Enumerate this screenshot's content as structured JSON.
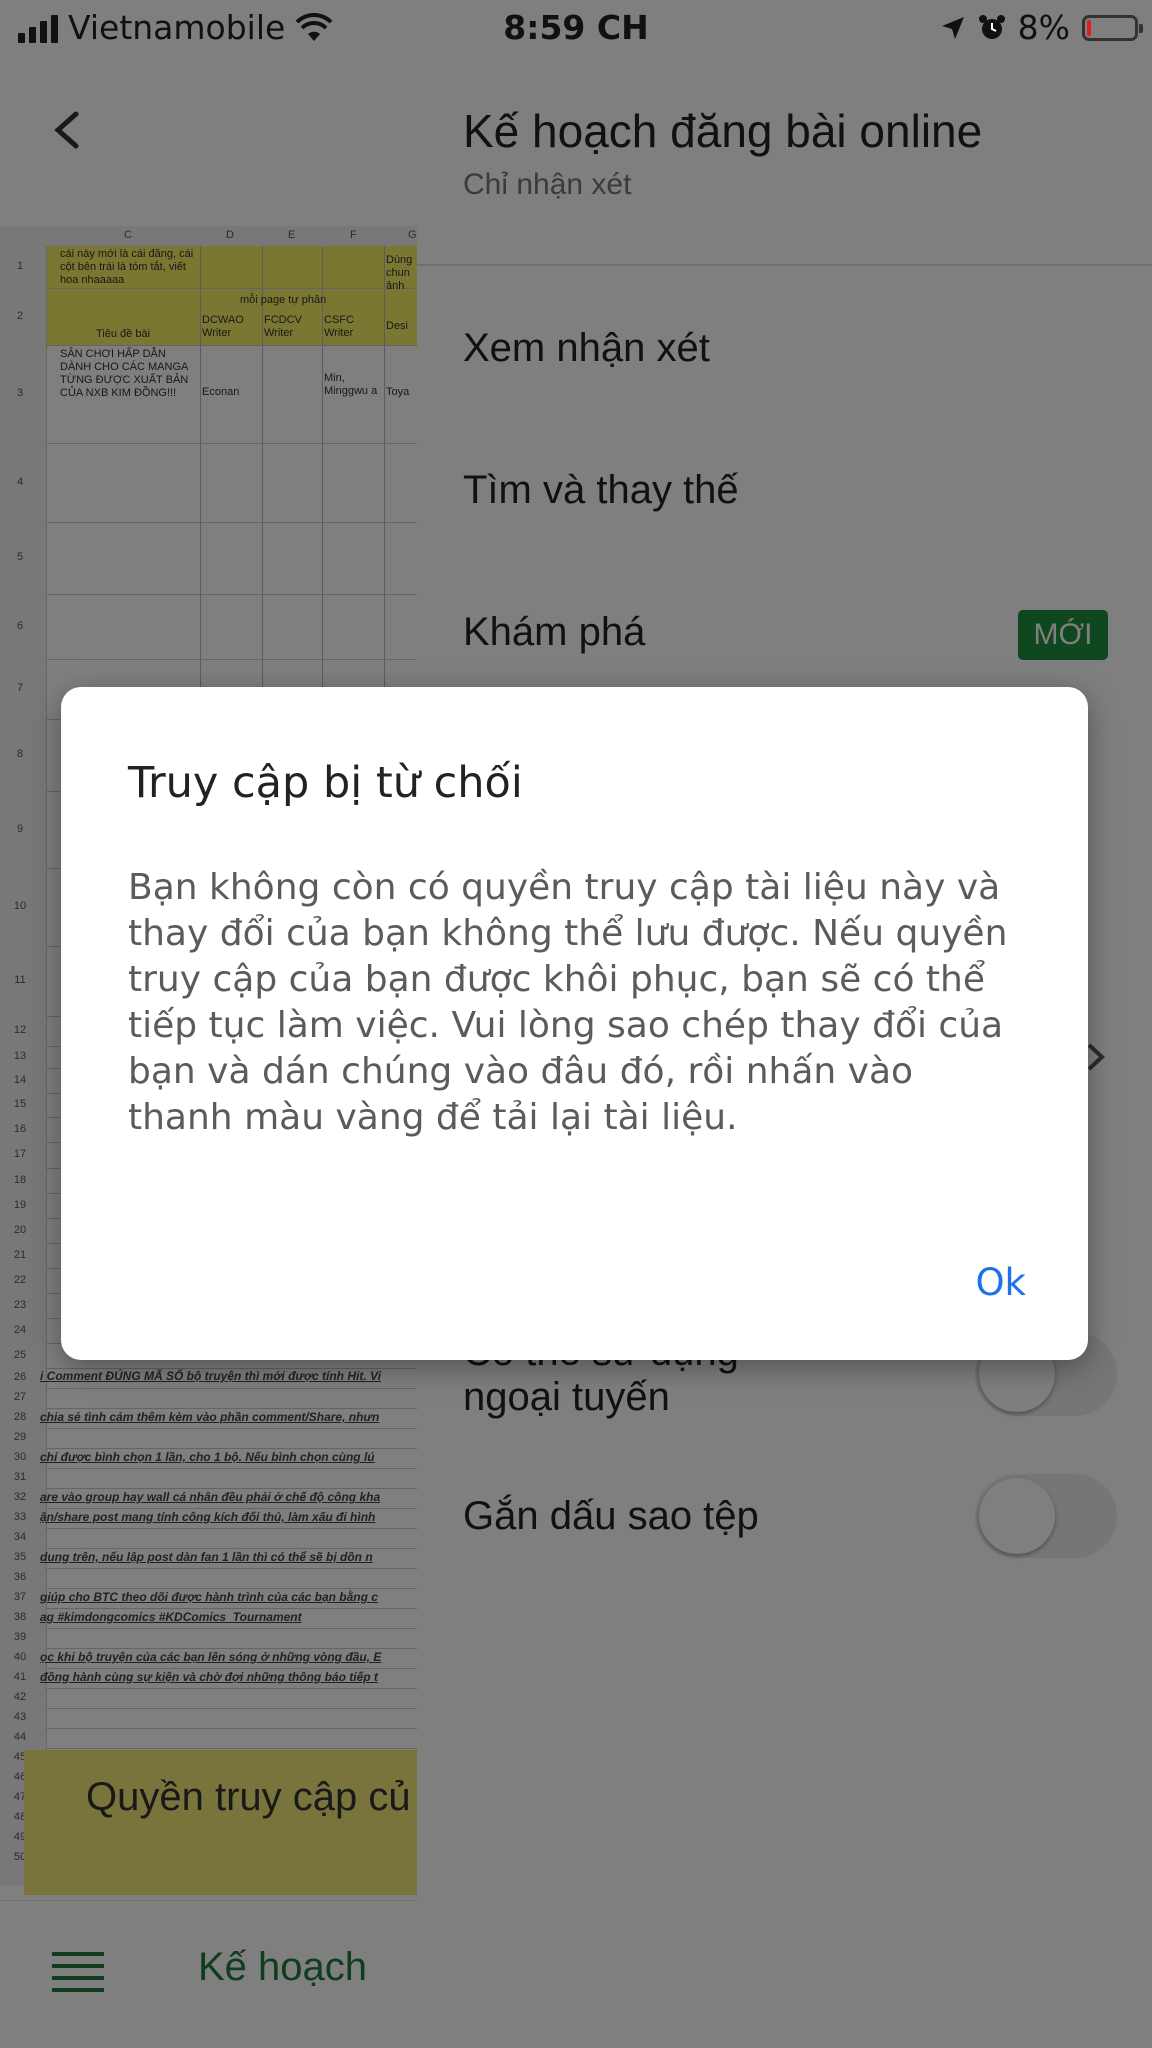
{
  "status_bar": {
    "carrier": "Vietnamobile",
    "time": "8:59 CH",
    "battery": "8%",
    "battery_level": 0.08
  },
  "spreadsheet": {
    "columns": [
      "C",
      "D",
      "E",
      "F",
      "G"
    ],
    "header_cells": {
      "c1": "cái này mới là cái đăng, cái cột bên trái là tóm tắt, viết hoa nhaaaaa",
      "d1": "mỗi page tự phân",
      "g1": "Dùng chun ảnh",
      "c2": "Tiêu đề bài",
      "d2": "DCWAO Writer",
      "e2": "FCDCV Writer",
      "f2": "CSFC Writer",
      "g2": "Desi",
      "c3": "SÂN CHƠI HẤP DẪN DÀNH CHO CÁC MANGA TỪNG ĐƯỢC XUẤT BẢN CỦA NXB KIM ĐỒNG!!!",
      "d3": "Econan",
      "f3": "Min, Minggwu a",
      "g3": "Toya"
    },
    "notes": [
      "i Comment ĐÚNG MÃ SỐ bộ truyện thì mới được tính Hit. Vi",
      "chia sẻ tình cảm thêm kèm vào phần comment/Share, nhưn",
      "chỉ được bình chọn 1 lần, cho 1 bộ. Nếu bình chọn cùng lú",
      "are vào group hay wall cá nhân đều phải ở chế độ công kha",
      "ận/share post mang tính công kích đối thủ, làm xấu đi hình",
      "dung trên, nếu lập post dàn fan 1 lần thì có thể sẽ bị dồn n",
      "giúp cho BTC theo dõi được hành trình của các bạn bằng c",
      "ag #kimdongcomics #KDComics_Tournament",
      "ọc khi bộ truyện của các bạn lên sóng ở những vòng đầu, E",
      "đồng hành cùng sự kiện và chờ đợi những thông báo tiếp t"
    ],
    "banner_text": "Quyền truy cập củ",
    "bottom_title": "Kế hoạch"
  },
  "panel": {
    "doc_title": "Kế hoạch đăng bài online",
    "doc_subtitle": "Chỉ nhận xét",
    "items": [
      {
        "label": "Xem nhận xét"
      },
      {
        "label": "Tìm và thay thế"
      },
      {
        "label": "Khám phá",
        "badge": "MỚI"
      }
    ],
    "offline_label_1": "Có thể sử dụng",
    "offline_label_2": "ngoại tuyến",
    "star_label": "Gắn dấu sao tệp"
  },
  "dialog": {
    "title": "Truy cập bị từ chối",
    "body": "Bạn không còn có quyền truy cập tài liệu này và thay đổi của bạn không thể lưu được. Nếu quyền truy cập của bạn được khôi phục, bạn sẽ có thể tiếp tục làm việc. Vui lòng sao chép thay đổi của bạn và dán chúng vào đâu đó, rồi nhấn vào thanh màu vàng để tải lại tài liệu.",
    "ok_label": "Ok"
  },
  "colors": {
    "accent_blue": "#1a73e8",
    "sheets_green": "#1e8e3e",
    "highlight_yellow": "#f3ef63",
    "battery_red": "#e02020"
  }
}
